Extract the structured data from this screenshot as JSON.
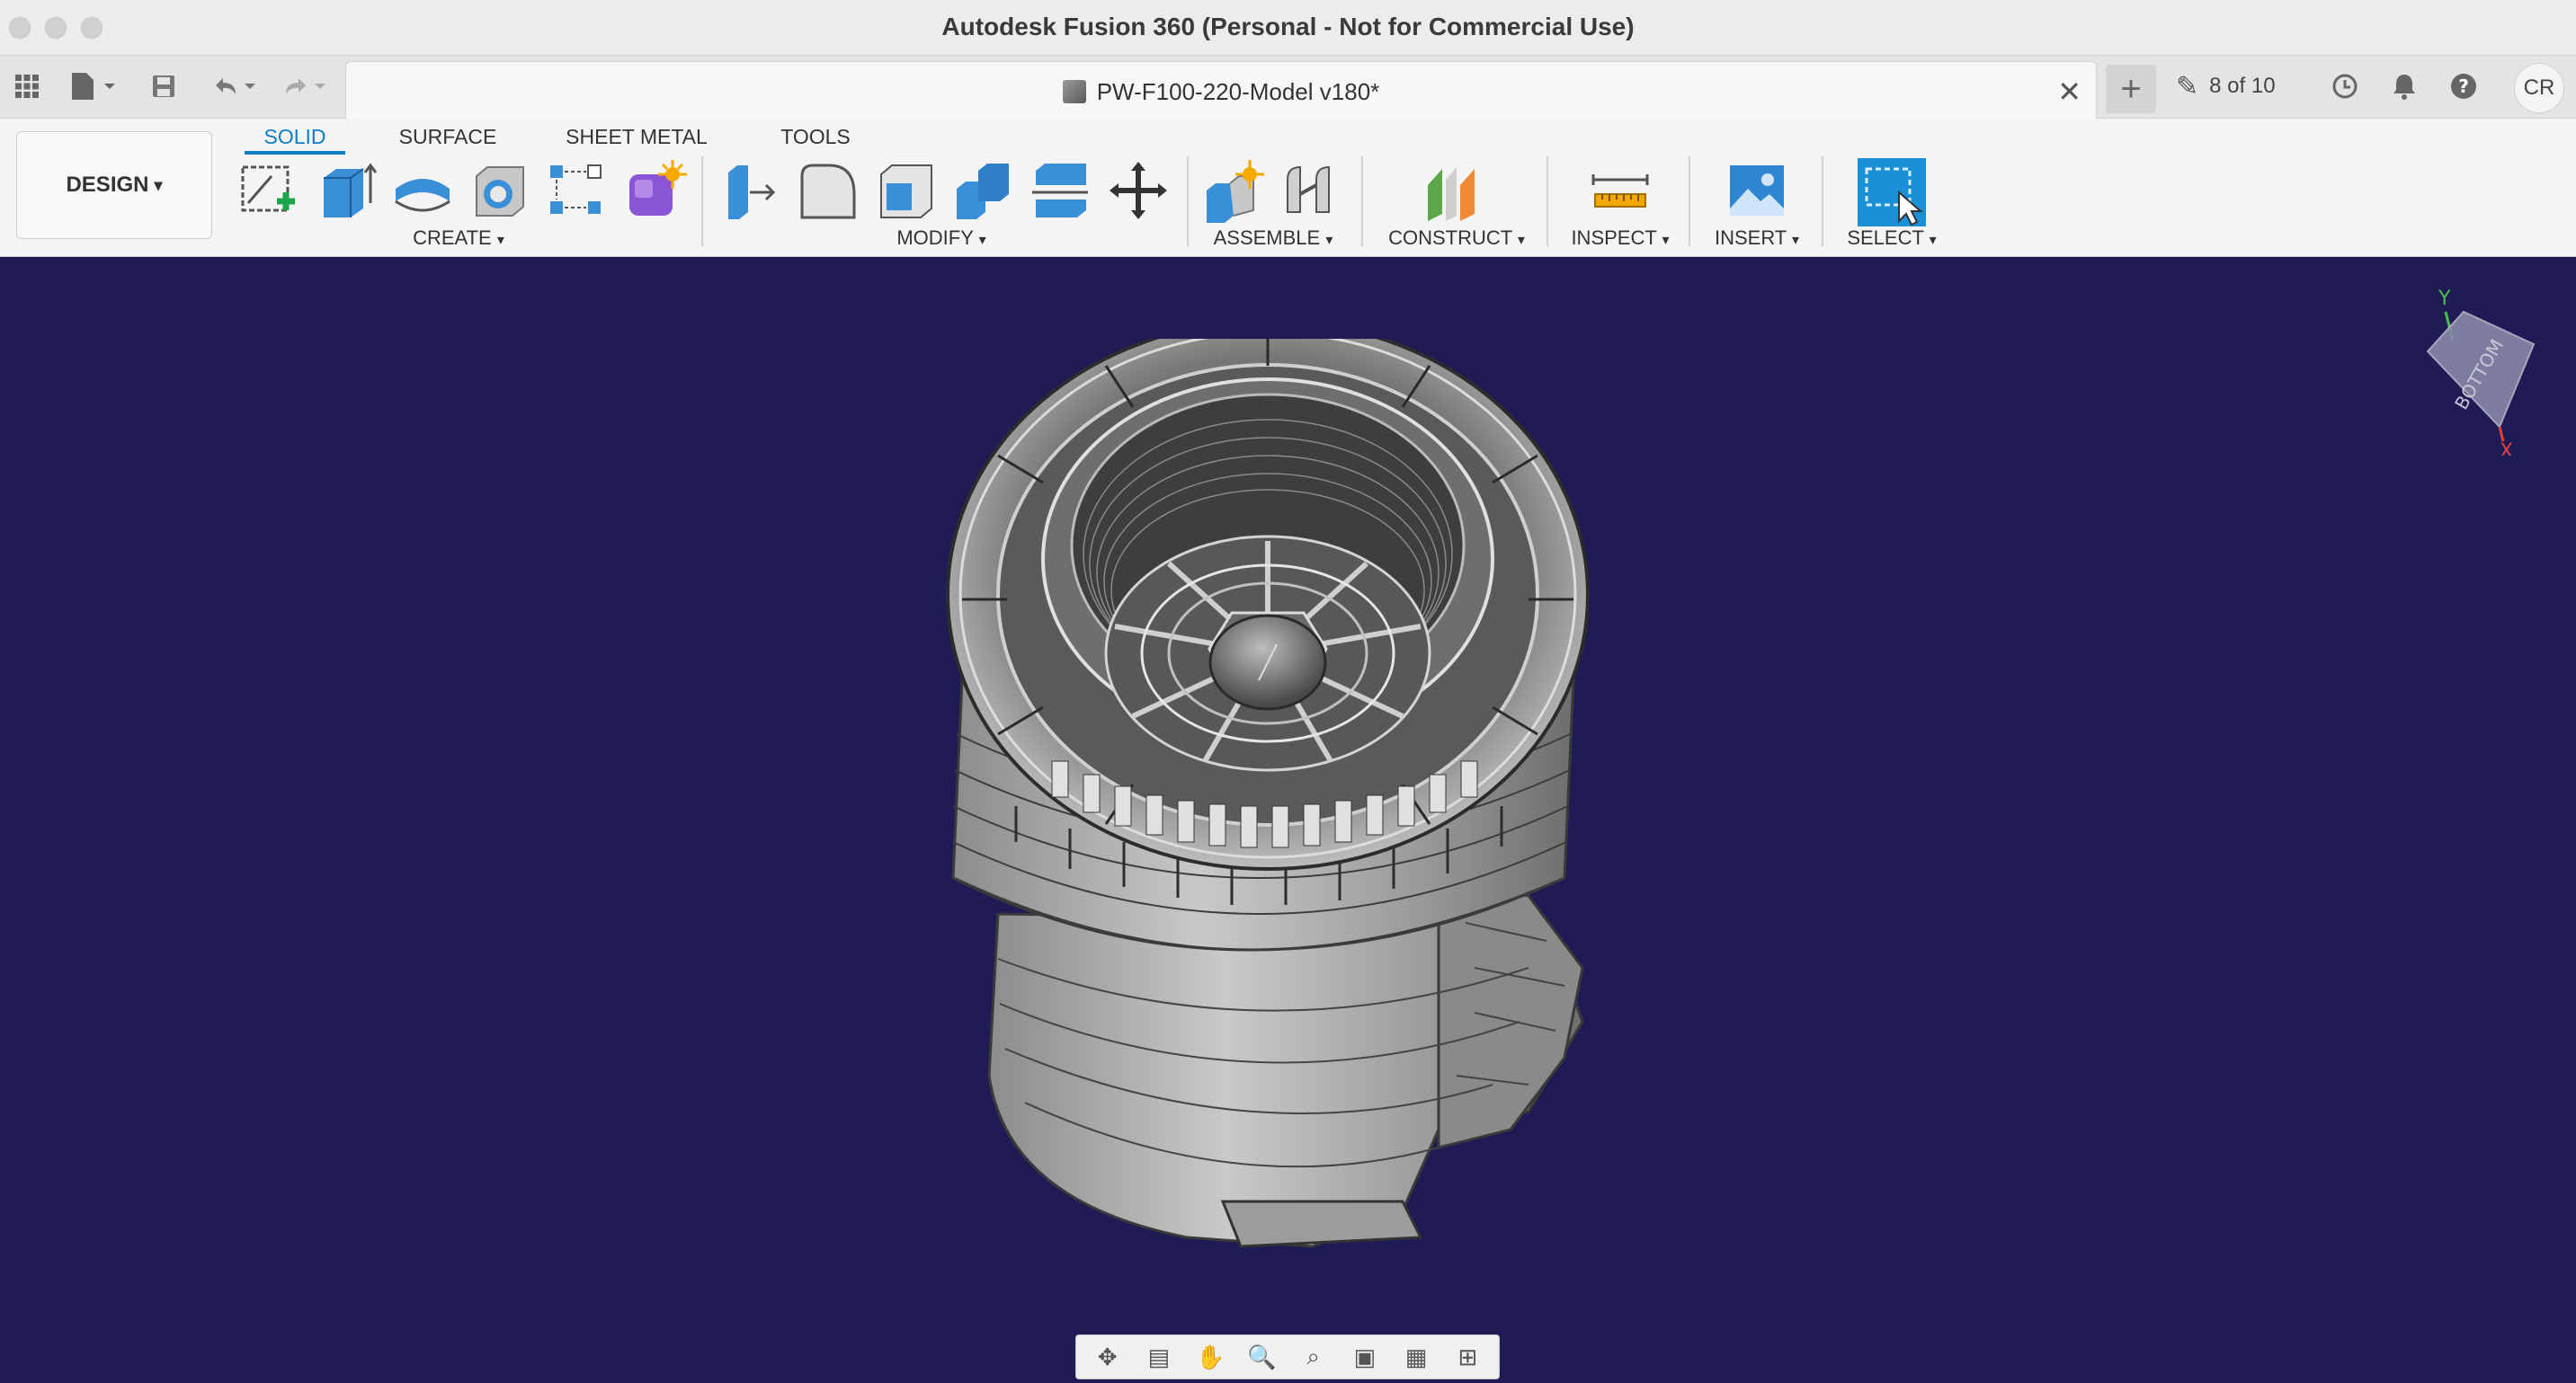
{
  "window": {
    "title": "Autodesk Fusion 360 (Personal - Not for Commercial Use)"
  },
  "tabbar": {
    "document_title": "PW-F100-220-Model v180*",
    "version_text": "8 of 10",
    "user_initials": "CR",
    "icons": [
      "apps-grid-icon",
      "file-icon",
      "save-icon",
      "undo-icon",
      "redo-icon",
      "close-icon",
      "plus-icon",
      "history-icon",
      "bell-icon",
      "help-icon"
    ]
  },
  "ribbon": {
    "workspace_label": "DESIGN",
    "tabs": [
      {
        "label": "SOLID",
        "active": true
      },
      {
        "label": "SURFACE",
        "active": false
      },
      {
        "label": "SHEET METAL",
        "active": false
      },
      {
        "label": "TOOLS",
        "active": false
      }
    ],
    "groups": {
      "create": "CREATE",
      "modify": "MODIFY",
      "assemble": "ASSEMBLE",
      "construct": "CONSTRUCT",
      "inspect": "INSPECT",
      "insert": "INSERT",
      "select": "SELECT"
    },
    "dropdown_glyph": "▾"
  },
  "viewcube": {
    "face": "BOTTOM",
    "axis_y": "Y",
    "axis_x": "X"
  },
  "colors": {
    "accent": "#0f7dc1",
    "viewport_bg": "#1e1b55",
    "select_blue": "#1a90d6"
  }
}
